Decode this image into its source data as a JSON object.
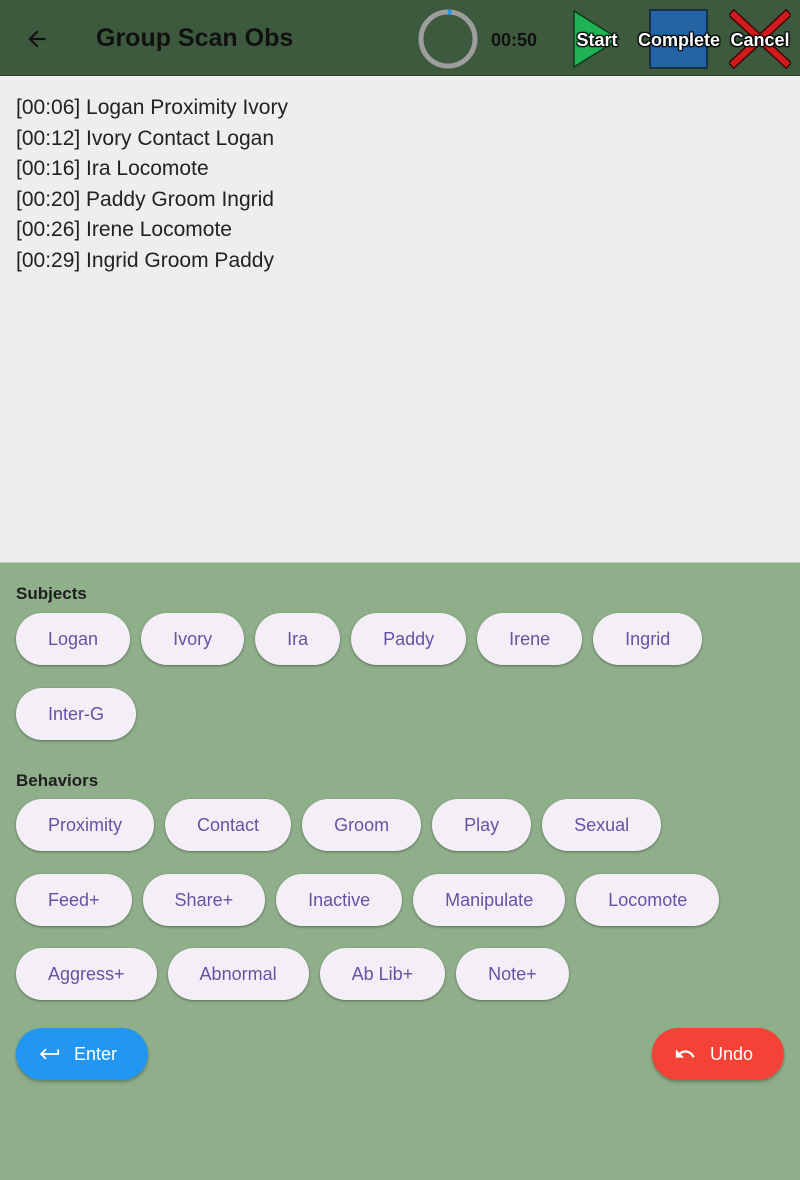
{
  "appbar": {
    "title": "Group Scan Obs",
    "timer": "00:50",
    "start_label": "Start",
    "complete_label": "Complete",
    "cancel_label": "Cancel",
    "progress": 0.02
  },
  "log": [
    "[00:06] Logan Proximity Ivory",
    "[00:12] Ivory Contact Logan",
    "[00:16] Ira Locomote",
    "[00:20] Paddy Groom Ingrid",
    "[00:26] Irene Locomote",
    "[00:29] Ingrid Groom Paddy"
  ],
  "subjects": {
    "label": "Subjects",
    "items": [
      "Logan",
      "Ivory",
      "Ira",
      "Paddy",
      "Irene",
      "Ingrid",
      "Inter-G"
    ]
  },
  "behaviors": {
    "label": "Behaviors",
    "items": [
      "Proximity",
      "Contact",
      "Groom",
      "Play",
      "Sexual",
      "Feed+",
      "Share+",
      "Inactive",
      "Manipulate",
      "Locomote",
      "Aggress+",
      "Abnormal",
      "Ab Lib+",
      "Note+"
    ]
  },
  "actions": {
    "enter_label": "Enter",
    "undo_label": "Undo"
  },
  "colors": {
    "appbar": "#3e5a3e",
    "panel": "#8faf8a",
    "chip_text": "#6552a4",
    "enter": "#2196f3",
    "undo": "#f44336",
    "start": "#1fb356",
    "complete": "#2464a4",
    "cancel": "#d11a1a"
  },
  "icons": {
    "back": "arrow-back-icon",
    "start": "play-triangle-icon",
    "complete": "stop-square-icon",
    "cancel": "x-cross-icon",
    "enter": "keyboard-return-icon",
    "undo": "undo-icon"
  }
}
